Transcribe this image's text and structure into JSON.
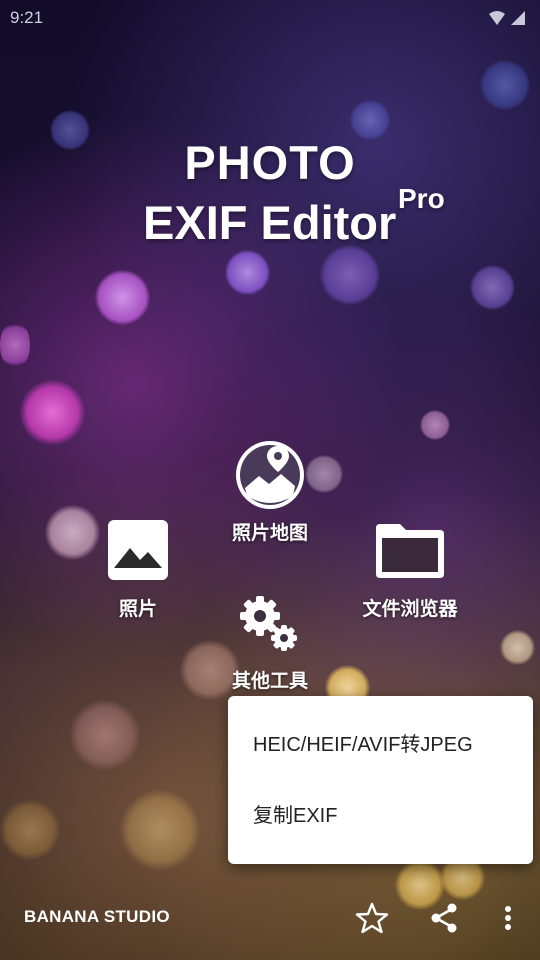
{
  "status_bar": {
    "time": "9:21"
  },
  "title": {
    "line1": "PHOTO",
    "line2": "EXIF Editor",
    "superscript": "Pro"
  },
  "menu": {
    "map": "照片地图",
    "photos": "照片",
    "file_browser": "文件浏览器",
    "other_tools": "其他工具"
  },
  "popup": {
    "items": [
      "HEIC/HEIF/AVIF转JPEG",
      "复制EXIF"
    ]
  },
  "footer": {
    "brand": "BANANA STUDIO"
  },
  "icons": {
    "photo": "image-icon",
    "map": "map-pin-icon",
    "folder": "folder-icon",
    "tools": "gears-icon",
    "favorite": "star-icon",
    "share": "share-icon",
    "more": "more-vert-icon"
  }
}
